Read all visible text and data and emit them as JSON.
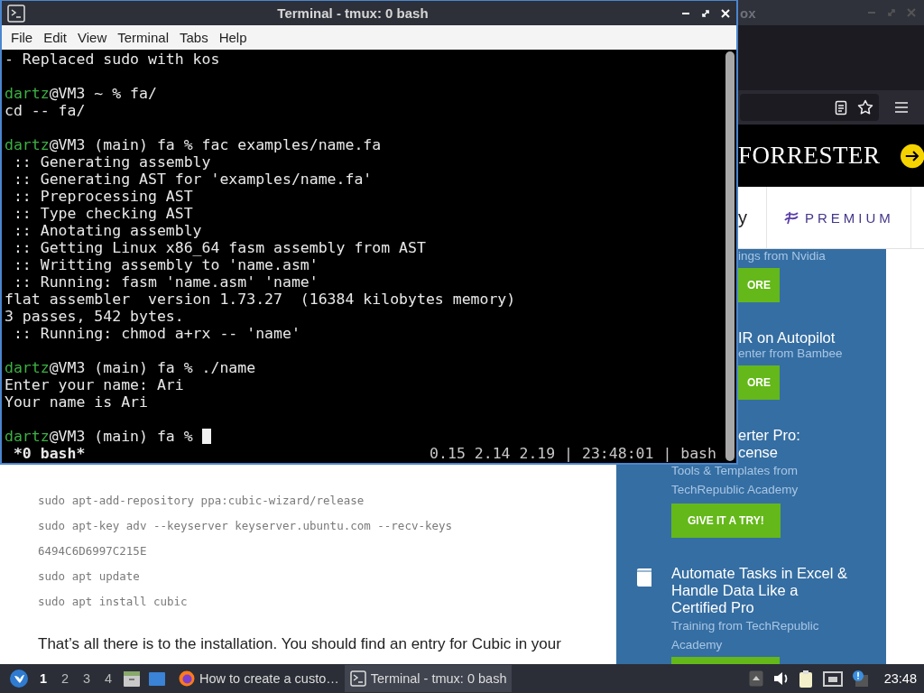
{
  "browser": {
    "title": "ox",
    "banner": {
      "brand": "FORRESTER"
    },
    "nav_strip": {
      "item_1": "y",
      "premium": "PREMIUM"
    },
    "sidebar": {
      "items": [
        {
          "meta": "ings from Nvidia",
          "button": "ORE"
        },
        {
          "title": "IR on Autopilot",
          "meta": "enter from Bambee",
          "button": "ORE"
        },
        {
          "title": "erter Pro:\ncense",
          "meta": "Tools & Templates from TechRepublic Academy",
          "button": "GIVE IT A TRY!"
        },
        {
          "title": "Automate Tasks in Excel & Handle Data Like a Certified Pro",
          "meta": "Training from TechRepublic Academy",
          "partial_button": true
        }
      ]
    },
    "article": {
      "code_lines": [
        "sudo apt-add-repository ppa:cubic-wizard/release",
        "sudo apt-key adv --keyserver keyserver.ubuntu.com --recv-keys",
        "6494C6D6997C215E",
        "sudo apt update",
        "sudo apt install cubic"
      ],
      "paragraph": "That’s all there is to the installation. You should find an entry for Cubic in your"
    }
  },
  "terminal": {
    "title": "Terminal - tmux: 0 bash",
    "menu": [
      "File",
      "Edit",
      "View",
      "Terminal",
      "Tabs",
      "Help"
    ],
    "lines": [
      {
        "kind": "output",
        "text": "- Replaced sudo with kos"
      },
      {
        "kind": "blank"
      },
      {
        "kind": "prompt",
        "user": "dartz",
        "text": "@VM3 ~ % fa/"
      },
      {
        "kind": "output",
        "text": "cd -- fa/"
      },
      {
        "kind": "blank"
      },
      {
        "kind": "prompt",
        "user": "dartz",
        "text": "@VM3 (main) fa % fac examples/name.fa"
      },
      {
        "kind": "output",
        "text": " :: Generating assembly"
      },
      {
        "kind": "output",
        "text": " :: Generating AST for 'examples/name.fa'"
      },
      {
        "kind": "output",
        "text": " :: Preprocessing AST"
      },
      {
        "kind": "output",
        "text": " :: Type checking AST"
      },
      {
        "kind": "output",
        "text": " :: Anotating assembly"
      },
      {
        "kind": "output",
        "text": " :: Getting Linux x86_64 fasm assembly from AST"
      },
      {
        "kind": "output",
        "text": " :: Writting assembly to 'name.asm'"
      },
      {
        "kind": "output",
        "text": " :: Running: fasm 'name.asm' 'name'"
      },
      {
        "kind": "output",
        "text": "flat assembler  version 1.73.27  (16384 kilobytes memory)"
      },
      {
        "kind": "output",
        "text": "3 passes, 542 bytes."
      },
      {
        "kind": "output",
        "text": " :: Running: chmod a+rx -- 'name'"
      },
      {
        "kind": "blank"
      },
      {
        "kind": "prompt",
        "user": "dartz",
        "text": "@VM3 (main) fa % ./name"
      },
      {
        "kind": "output",
        "text": "Enter your name: Ari"
      },
      {
        "kind": "output",
        "text": "Your name is Ari"
      },
      {
        "kind": "blank"
      },
      {
        "kind": "prompt",
        "user": "dartz",
        "text": "@VM3 (main) fa %",
        "cursor": true
      }
    ],
    "status_left": " *0 bash*",
    "status_right": "0.15 2.14 2.19 | 23:48:01 | bash"
  },
  "taskbar": {
    "workspaces": [
      {
        "label": "1",
        "selected": true
      },
      {
        "label": "2",
        "selected": false
      },
      {
        "label": "3",
        "selected": false
      },
      {
        "label": "4",
        "selected": false
      }
    ],
    "tasks": [
      {
        "label": "How to create a custo…",
        "selected": false
      },
      {
        "label": "Terminal - tmux: 0 bash",
        "selected": true
      }
    ],
    "clock": "23:48"
  }
}
